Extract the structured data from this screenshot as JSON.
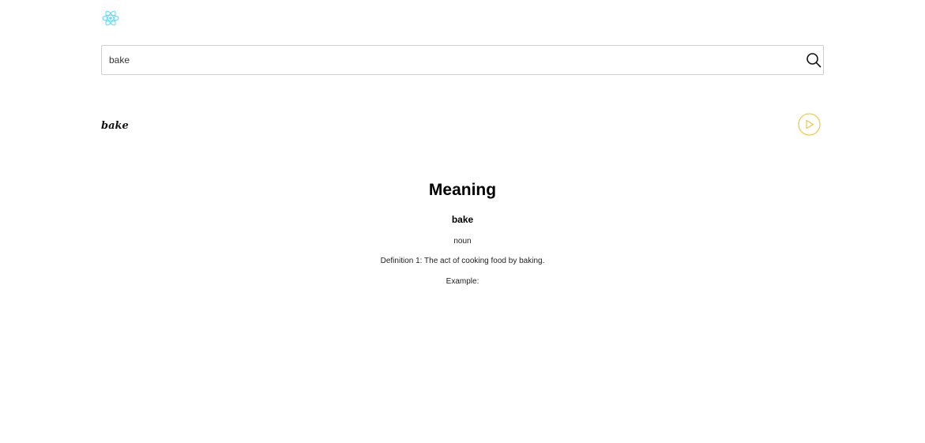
{
  "header": {
    "logo_icon": "react-atom-icon",
    "logo_color": "#61dafb"
  },
  "search": {
    "value": "bake",
    "button_icon": "search-icon"
  },
  "word": {
    "title": "bake",
    "audio_icon": "play-circle-icon",
    "audio_color": "#e8c33a"
  },
  "meaning": {
    "heading": "Meaning",
    "word": "bake",
    "part_of_speech": "noun",
    "definition": "Definition 1: The act of cooking food by baking.",
    "example": "Example:"
  }
}
